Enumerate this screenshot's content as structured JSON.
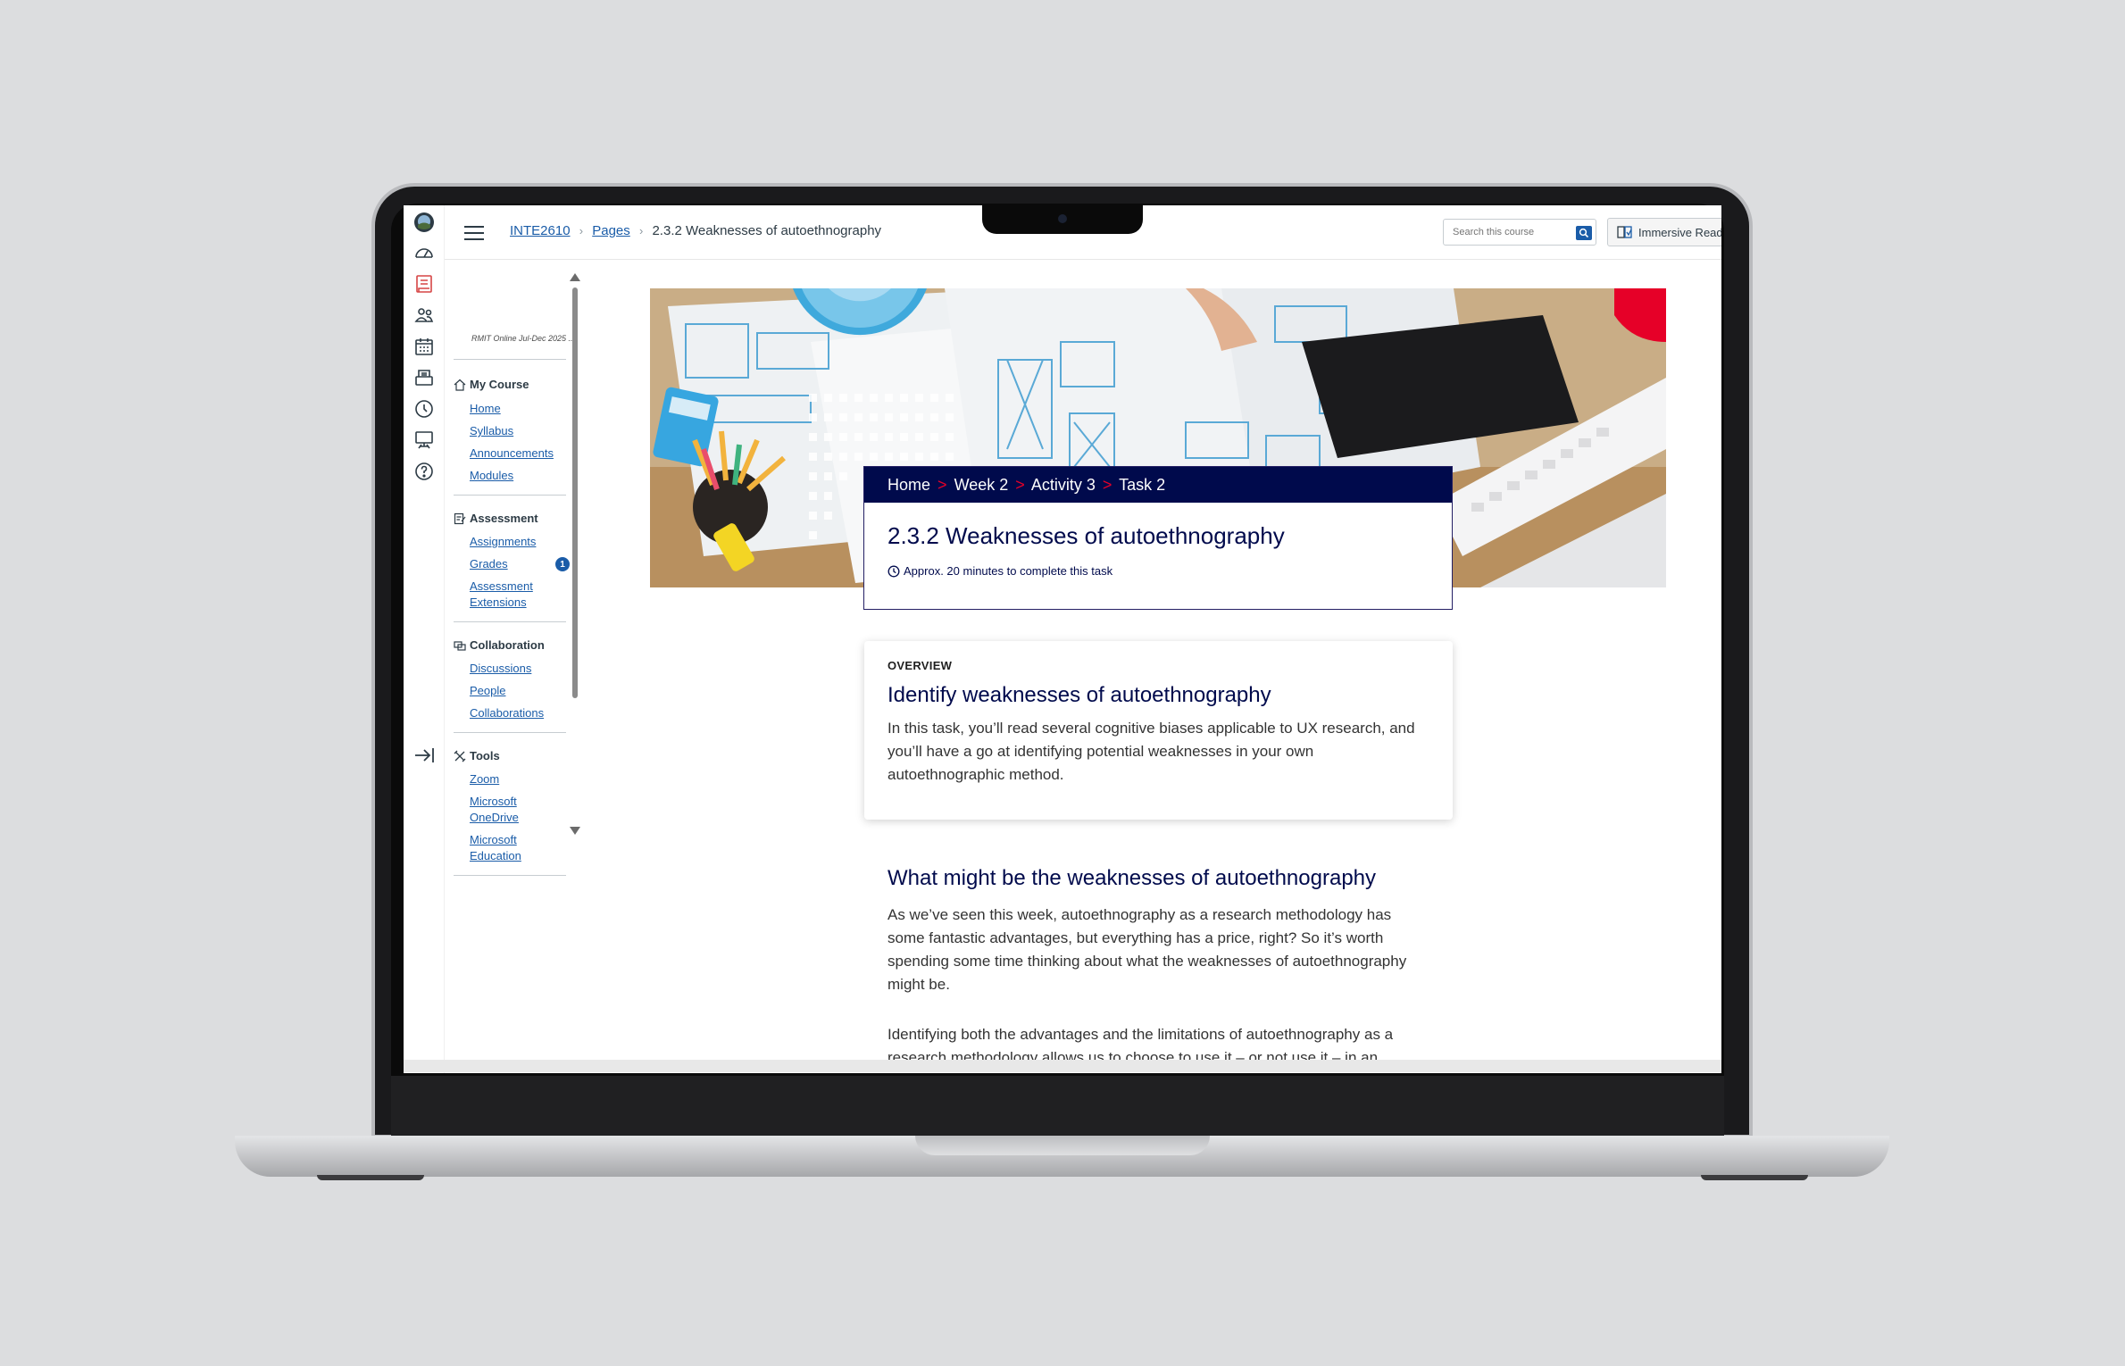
{
  "header": {
    "breadcrumb": [
      "INTE2610",
      "Pages",
      "2.3.2 Weaknesses of autoethnography"
    ],
    "search_placeholder": "Search this course",
    "immersive_reader": "Immersive Reader"
  },
  "course_nav": {
    "term": "RMIT Online Jul-Dec 2025 ...",
    "sections": [
      {
        "heading": "My Course",
        "links": [
          "Home",
          "Syllabus",
          "Announcements",
          "Modules"
        ]
      },
      {
        "heading": "Assessment",
        "links": [
          "Assignments",
          "Grades",
          "Assessment Extensions"
        ]
      },
      {
        "heading": "Collaboration",
        "links": [
          "Discussions",
          "People",
          "Collaborations"
        ]
      },
      {
        "heading": "Tools",
        "links": [
          "Zoom",
          "Microsoft OneDrive",
          "Microsoft Education"
        ]
      }
    ],
    "grades_badge": "1"
  },
  "page": {
    "crumb": [
      "Home",
      "Week 2",
      "Activity 3",
      "Task 2"
    ],
    "crumb_sep": ">",
    "title": "2.3.2 Weaknesses of autoethnography",
    "approx": "Approx. 20 minutes to complete this task",
    "overview_label": "OVERVIEW",
    "overview_title": "Identify weaknesses of autoethnography",
    "overview_body": "In this task, you’ll read several cognitive biases applicable to UX research, and you’ll have a go at identifying potential weaknesses in your own autoethnographic method.",
    "section_title": "What might be the weaknesses of autoethnography",
    "para1": "As we’ve seen this week, autoethnography as a research methodology has some fantastic advantages, but everything has a price, right? So it’s worth spending some time thinking about what the weaknesses of autoethnography might be.",
    "para2": "Identifying both the advantages and the limitations of autoethnography as a research methodology allows us to choose to use it – or not use it – in an"
  },
  "colors": {
    "navy": "#000a4c",
    "red": "#e60028",
    "link": "#1a5ca8"
  }
}
